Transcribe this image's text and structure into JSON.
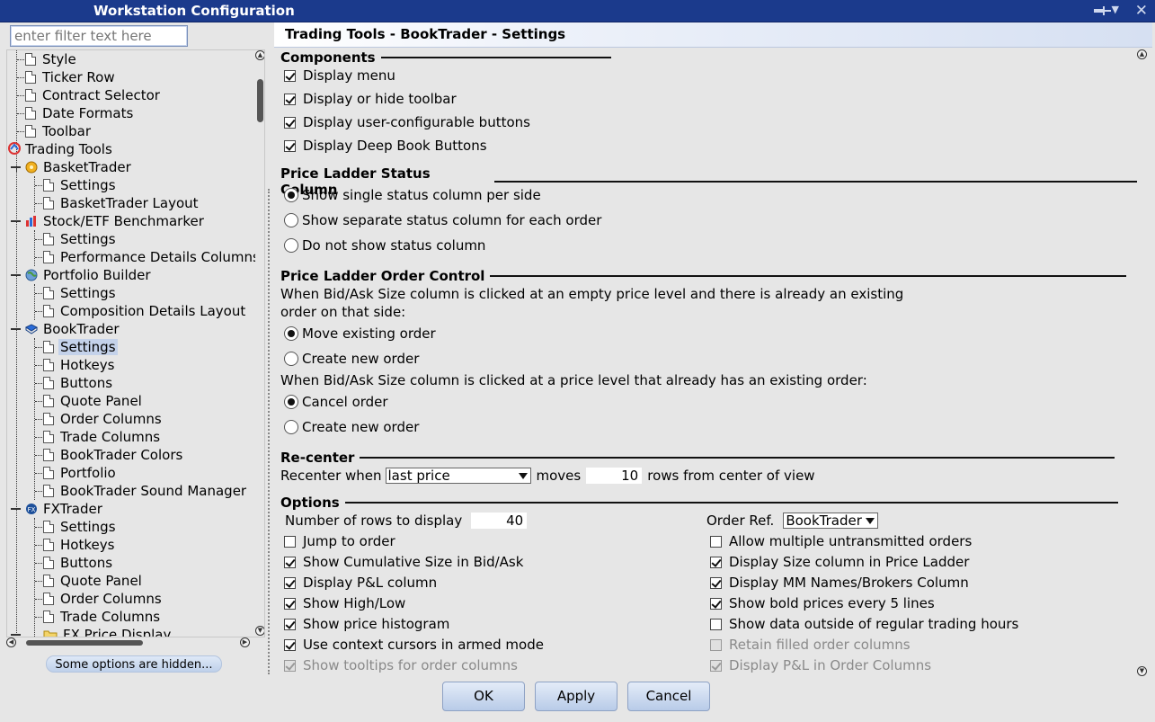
{
  "window": {
    "title": "Workstation Configuration"
  },
  "filter": {
    "placeholder": "enter filter text here"
  },
  "tree": {
    "style": "Style",
    "ticker_row": "Ticker Row",
    "contract_selector": "Contract Selector",
    "date_formats": "Date Formats",
    "toolbar": "Toolbar",
    "trading_tools": "Trading Tools",
    "basket_trader": "BasketTrader",
    "basket_settings": "Settings",
    "basket_layout": "BasketTrader Layout",
    "benchmarker": "Stock/ETF Benchmarker",
    "bench_settings": "Settings",
    "bench_perf": "Performance Details Columns",
    "portfolio_builder": "Portfolio Builder",
    "pb_settings": "Settings",
    "pb_comp": "Composition Details Layout",
    "booktrader": "BookTrader",
    "bt_settings": "Settings",
    "bt_hotkeys": "Hotkeys",
    "bt_buttons": "Buttons",
    "bt_quote": "Quote Panel",
    "bt_order_cols": "Order Columns",
    "bt_trade_cols": "Trade Columns",
    "bt_colors": "BookTrader Colors",
    "bt_portfolio": "Portfolio",
    "bt_sound": "BookTrader Sound Manager",
    "fxtrader": "FXTrader",
    "fx_settings": "Settings",
    "fx_hotkeys": "Hotkeys",
    "fx_buttons": "Buttons",
    "fx_quote": "Quote Panel",
    "fx_order_cols": "Order Columns",
    "fx_trade_cols": "Trade Columns",
    "fx_price_display": "FX Price Display"
  },
  "hidden_note": "Some options are hidden...",
  "panel": {
    "title": "Trading Tools - BookTrader - Settings",
    "components": {
      "heading": "Components",
      "items": [
        "Display menu",
        "Display or hide toolbar",
        "Display user-configurable buttons",
        "Display Deep Book Buttons"
      ]
    },
    "status_column": {
      "heading": "Price Ladder Status Column",
      "options": [
        "Show single status column per side",
        "Show separate status column for each order",
        "Do not show status column"
      ]
    },
    "order_control": {
      "heading": "Price Ladder Order Control",
      "desc1_line1": "When Bid/Ask Size column is clicked at an empty price level and there is already an existing",
      "desc1_line2": "order on that side:",
      "opt1a": "Move existing order",
      "opt1b": "Create new order",
      "desc2": "When Bid/Ask Size column is clicked at a price level that already has an existing order:",
      "opt2a": "Cancel order",
      "opt2b": "Create new order"
    },
    "recenter": {
      "heading": "Re-center",
      "prefix": "Recenter when",
      "trigger": "last price",
      "moves": "moves",
      "rows": "10",
      "suffix": "rows from center of view"
    },
    "options": {
      "heading": "Options",
      "rows_label": "Number of rows to display",
      "rows_value": "40",
      "order_ref_label": "Order Ref.",
      "order_ref_value": "BookTrader",
      "left": [
        "Jump to order",
        "Show Cumulative Size in Bid/Ask",
        "Display P&L column",
        "Show High/Low",
        "Show price histogram",
        "Use context cursors in armed mode",
        "Show tooltips for order columns"
      ],
      "right": [
        "Allow multiple untransmitted orders",
        "Display Size column in Price Ladder",
        "Display MM Names/Brokers Column",
        "Show bold prices every 5 lines",
        "Show data outside of regular trading hours",
        "Retain filled order columns",
        "Display P&L in Order Columns"
      ]
    }
  },
  "buttons": {
    "ok": "OK",
    "apply": "Apply",
    "cancel": "Cancel"
  }
}
